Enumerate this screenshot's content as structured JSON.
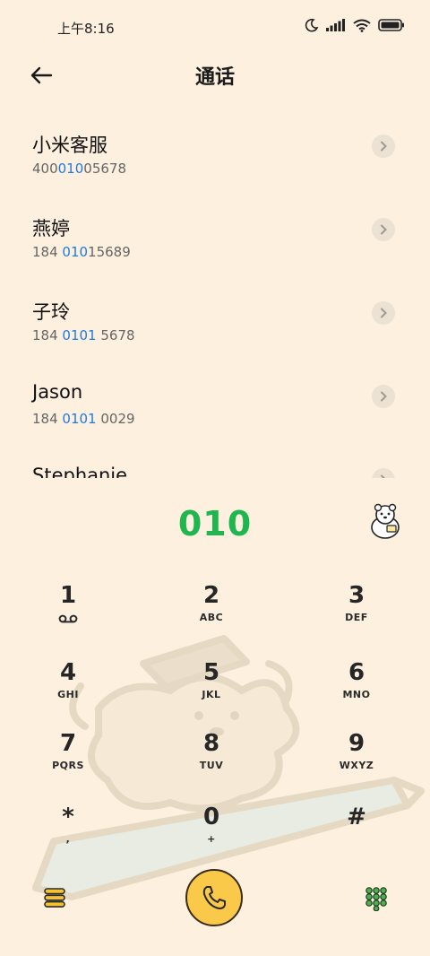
{
  "status_bar": {
    "time": "上午8:16"
  },
  "header": {
    "title": "通话"
  },
  "contacts": [
    {
      "name": "小米客服",
      "number_pre": "400",
      "number_hl": "010",
      "number_post": "05678"
    },
    {
      "name": "燕婷",
      "number_pre": "184 ",
      "number_hl": "010",
      "number_post": "15689"
    },
    {
      "name": "子玲",
      "number_pre": "184 ",
      "number_hl": "0101",
      "number_post": " 5678"
    },
    {
      "name": "Jason",
      "number_pre": "184 ",
      "number_hl": "0101",
      "number_post": " 0029"
    },
    {
      "name": "Stephanie",
      "number_pre": "",
      "number_hl": "",
      "number_post": ""
    }
  ],
  "dial": {
    "number": "010"
  },
  "keypad": {
    "k1": {
      "digit": "1",
      "letters": ""
    },
    "k2": {
      "digit": "2",
      "letters": "ABC"
    },
    "k3": {
      "digit": "3",
      "letters": "DEF"
    },
    "k4": {
      "digit": "4",
      "letters": "GHI"
    },
    "k5": {
      "digit": "5",
      "letters": "JKL"
    },
    "k6": {
      "digit": "6",
      "letters": "MNO"
    },
    "k7": {
      "digit": "7",
      "letters": "PQRS"
    },
    "k8": {
      "digit": "8",
      "letters": "TUV"
    },
    "k9": {
      "digit": "9",
      "letters": "WXYZ"
    },
    "kstar": {
      "digit": "*",
      "letters": ","
    },
    "k0": {
      "digit": "0",
      "letters": "+"
    },
    "khash": {
      "digit": "#",
      "letters": ""
    }
  },
  "colors": {
    "accent_green": "#1fb650",
    "highlight_blue": "#1f7ae0",
    "call_yellow": "#fbc94a",
    "background": "#fdf0df"
  }
}
